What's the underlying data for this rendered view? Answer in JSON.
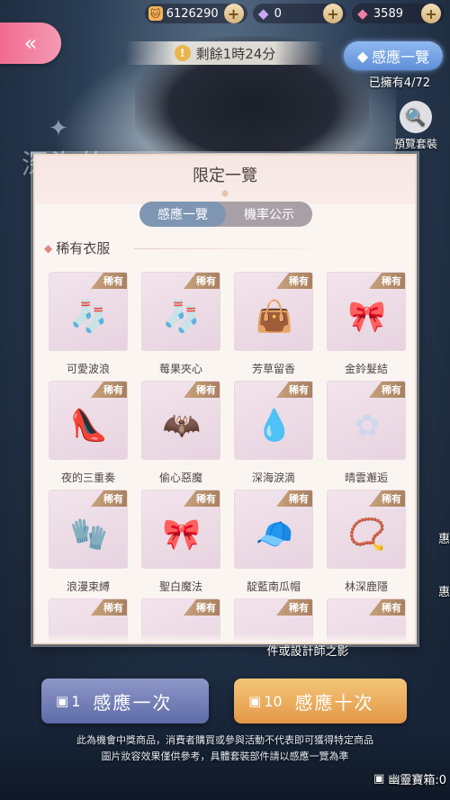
{
  "resources": [
    {
      "icon": "cat-coin-icon",
      "glyph": "🐱",
      "value": "6126290"
    },
    {
      "icon": "purple-crystal-icon",
      "glyph": "◆",
      "value": "0"
    },
    {
      "icon": "pink-diamond-icon",
      "glyph": "◆",
      "value": "3589"
    }
  ],
  "back_label": "«",
  "timer": "剩餘1時24分",
  "gacha_tab": "感應一覽",
  "owned": "已擁有4/72",
  "preview_label": "預覽套裝",
  "modal": {
    "title": "限定一覽",
    "tabs": [
      "感應一覽",
      "機率公示"
    ],
    "section": "稀有衣服",
    "rare_badge": "稀有"
  },
  "items": [
    {
      "name": "可愛波浪",
      "icon": "socks-icon",
      "glyph": "🧦"
    },
    {
      "name": "莓果夾心",
      "icon": "socks-icon",
      "glyph": "🧦"
    },
    {
      "name": "芳草留香",
      "icon": "handbag-icon",
      "glyph": "👜"
    },
    {
      "name": "金鈴髮結",
      "icon": "bow-icon",
      "glyph": "🎀"
    },
    {
      "name": "夜的三重奏",
      "icon": "heels-icon",
      "glyph": "👠"
    },
    {
      "name": "偷心惡魔",
      "icon": "bat-wing-icon",
      "glyph": "🦇"
    },
    {
      "name": "深海淚滴",
      "icon": "earring-icon",
      "glyph": "💧"
    },
    {
      "name": "晴雲邂逅",
      "icon": "hairclip-icon",
      "glyph": "✿"
    },
    {
      "name": "浪漫束縛",
      "icon": "gloves-icon",
      "glyph": "🧤"
    },
    {
      "name": "聖白魔法",
      "icon": "choker-icon",
      "glyph": "🎀"
    },
    {
      "name": "靛藍南瓜帽",
      "icon": "cap-icon",
      "glyph": "🧢"
    },
    {
      "name": "林深鹿隱",
      "icon": "necklace-icon",
      "glyph": "📿"
    }
  ],
  "scroll_text": "件或設計師之影",
  "btn_one": {
    "count": "1",
    "label": "感應一次"
  },
  "btn_ten": {
    "count": "10",
    "label": "感應十次"
  },
  "disclaimer": [
    "此為機會中獎商品，消費者購買或參與活動不代表即可獲得特定商品",
    "圖片妝容效果僅供參考，具體套裝部件請以感應一覽為準"
  ],
  "ghost_box": "幽靈寶箱:0",
  "side_peek": [
    "惠",
    "惠"
  ]
}
